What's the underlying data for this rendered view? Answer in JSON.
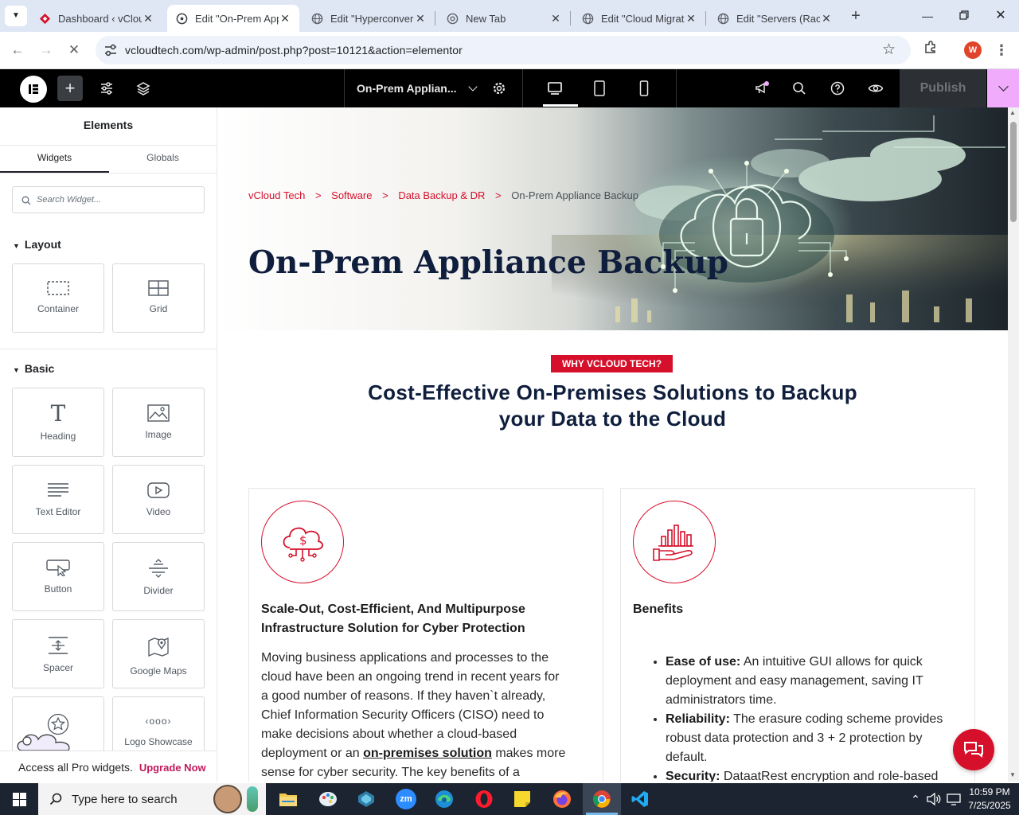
{
  "browser": {
    "tabs": [
      {
        "title": "Dashboard ‹ vCloud",
        "close": "✕"
      },
      {
        "title": "Edit \"On-Prem App",
        "close": "✕"
      },
      {
        "title": "Edit \"Hyperconver",
        "close": "✕"
      },
      {
        "title": "New Tab",
        "close": "✕"
      },
      {
        "title": "Edit \"Cloud Migrat",
        "close": "✕"
      },
      {
        "title": "Edit \"Servers (Rack",
        "close": "✕"
      }
    ],
    "url": "vcloudtech.com/wp-admin/post.php?post=10121&action=elementor",
    "profile_initial": "W"
  },
  "elementor": {
    "page_title": "On-Prem Applian...",
    "publish_label": "Publish"
  },
  "panel": {
    "title": "Elements",
    "tabs": [
      "Widgets",
      "Globals"
    ],
    "search_placeholder": "Search Widget...",
    "layout_section": "Layout",
    "layout_widgets": [
      "Container",
      "Grid"
    ],
    "basic_section": "Basic",
    "basic_widgets": [
      "Heading",
      "Image",
      "Text Editor",
      "Video",
      "Button",
      "Divider",
      "Spacer",
      "Google Maps",
      "",
      "Logo Showcase"
    ],
    "promo_text": "Access all Pro widgets.",
    "promo_link": "Upgrade Now"
  },
  "page": {
    "breadcrumb": [
      "vCloud Tech",
      "Software",
      "Data Backup & DR",
      "On-Prem Appliance Backup"
    ],
    "breadcrumb_sep": ">",
    "hero_title": "On-Prem Appliance Backup",
    "badge": "WHY VCLOUD TECH?",
    "section_heading_1": "Cost-Effective On-Premises Solutions to Backup",
    "section_heading_2": "your Data to the Cloud",
    "card1": {
      "title_1": "Scale-Out, Cost-Efficient, And Multipurpose",
      "title_2": "Infrastructure Solution for Cyber Protection",
      "lines": [
        "Moving business applications and processes to the",
        "cloud have been an ongoing trend in recent years for",
        "a good number of reasons. If they haven`t already,",
        "Chief Information Security Officers (CISO) need to",
        "make decisions about whether a cloud-based"
      ],
      "line6_before": "deployment or an ",
      "line6_link": "on-premises solution",
      "line6_after": " makes more",
      "line7": "sense for cyber security. The key benefits of a"
    },
    "card2": {
      "title": "Benefits",
      "bullets": [
        {
          "label": "Ease of use:",
          "lines": [
            " An intuitive GUI allows for quick",
            "deployment and easy management, saving IT",
            "administrators time."
          ]
        },
        {
          "label": "Reliability:",
          "lines": [
            " The erasure coding scheme provides",
            "robust data protection and 3 + 2 protection by",
            "default."
          ]
        },
        {
          "label": "Security:",
          "lines": [
            " DataatRest encryption and role-based"
          ]
        }
      ]
    }
  },
  "taskbar": {
    "search_placeholder": "Type here to search",
    "time": "10:59 PM",
    "date": "7/25/2025"
  },
  "colors": {
    "accent_red": "#d6102b",
    "navy": "#0f1e3d",
    "elementor_pink": "#f0abfc"
  }
}
